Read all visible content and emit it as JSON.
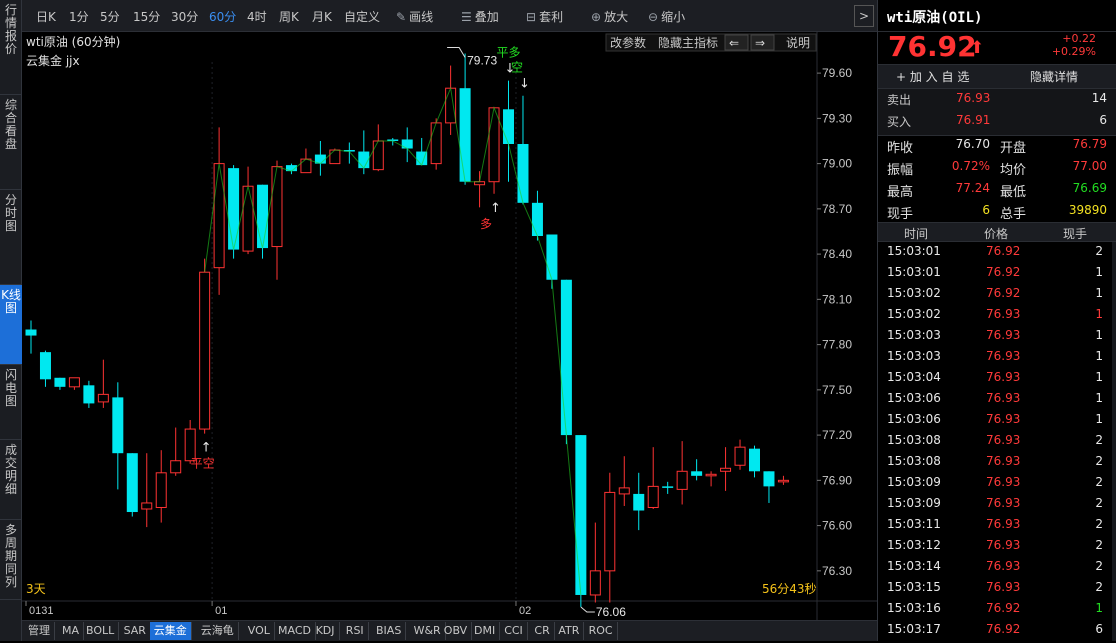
{
  "side_tabs": [
    {
      "label": "行情报价",
      "active": false
    },
    {
      "label": "综合看盘",
      "active": false
    },
    {
      "label": "分时图",
      "active": false
    },
    {
      "label": "K线图",
      "active": true
    },
    {
      "label": "闪电图",
      "active": false
    },
    {
      "label": "成交明细",
      "active": false
    },
    {
      "label": "多周期同列",
      "active": false
    }
  ],
  "toolbar": {
    "periods": [
      {
        "label": "日K",
        "selected": false
      },
      {
        "label": "1分",
        "selected": false
      },
      {
        "label": "5分",
        "selected": false
      },
      {
        "label": "15分",
        "selected": false
      },
      {
        "label": "30分",
        "selected": false
      },
      {
        "label": "60分",
        "selected": true
      },
      {
        "label": "4时",
        "selected": false
      },
      {
        "label": "周K",
        "selected": false
      },
      {
        "label": "月K",
        "selected": false
      },
      {
        "label": "自定义",
        "selected": false
      }
    ],
    "tools": [
      {
        "label": "画线",
        "icon": "pencil-icon"
      },
      {
        "label": "叠加",
        "icon": "stack-icon"
      },
      {
        "label": "套利",
        "icon": "arbitrage-icon"
      },
      {
        "label": "放大",
        "icon": "zoom-in-icon"
      },
      {
        "label": "缩小",
        "icon": "zoom-out-icon"
      }
    ],
    "expand_glyph": ">"
  },
  "chart_header": {
    "title": "wti原油 (60分钟)",
    "indicator": "云集金 jjx",
    "buttons": [
      "改参数",
      "隐藏主指标"
    ],
    "prev_glyph": "⇐",
    "next_glyph": "⇒",
    "help": "说明"
  },
  "chart_footer": {
    "period_left": "3天",
    "countdown": "56分43秒"
  },
  "chart_data": {
    "type": "candlestick",
    "title": "wti原油 (60分钟)",
    "y_ticks": [
      79.6,
      79.3,
      79.0,
      78.7,
      78.4,
      78.1,
      77.8,
      77.5,
      77.2,
      76.9,
      76.6,
      76.3
    ],
    "ylim": [
      76.1,
      79.74
    ],
    "x_date_labels": [
      {
        "index": 0,
        "label": "0131"
      },
      {
        "index": 13,
        "label": "01"
      },
      {
        "index": 34,
        "label": "02"
      }
    ],
    "high_label": "79.73",
    "low_label": "76.06",
    "colors": {
      "up": "#ff3333",
      "down": "#00e8f0",
      "ma": "#22cc22"
    },
    "candles": [
      [
        77.9,
        77.86,
        77.96,
        77.74
      ],
      [
        77.75,
        77.57,
        77.76,
        77.52
      ],
      [
        77.58,
        77.52,
        77.58,
        77.5
      ],
      [
        77.52,
        77.58,
        77.58,
        77.5
      ],
      [
        77.53,
        77.41,
        77.56,
        77.38
      ],
      [
        77.42,
        77.47,
        77.7,
        77.38
      ],
      [
        77.45,
        77.08,
        77.55,
        76.84
      ],
      [
        77.08,
        76.69,
        77.08,
        76.66
      ],
      [
        76.71,
        76.75,
        77.08,
        76.59
      ],
      [
        76.72,
        76.95,
        77.1,
        76.62
      ],
      [
        76.95,
        77.03,
        77.25,
        76.93
      ],
      [
        77.03,
        77.24,
        77.3,
        77.01
      ],
      [
        77.24,
        78.28,
        78.37,
        77.21
      ],
      [
        78.31,
        79.0,
        79.24,
        78.13
      ],
      [
        78.97,
        78.43,
        78.99,
        78.37
      ],
      [
        78.42,
        78.85,
        78.98,
        78.4
      ],
      [
        78.86,
        78.44,
        78.86,
        78.37
      ],
      [
        78.45,
        78.98,
        79.02,
        78.23
      ],
      [
        78.99,
        78.95,
        79.0,
        78.93
      ],
      [
        78.94,
        79.03,
        79.1,
        78.94
      ],
      [
        79.06,
        79.0,
        79.15,
        78.92
      ],
      [
        79.0,
        79.09,
        79.1,
        79.0
      ],
      [
        79.09,
        79.08,
        79.14,
        79.0
      ],
      [
        79.08,
        78.97,
        79.22,
        78.93
      ],
      [
        78.96,
        79.15,
        79.26,
        78.95
      ],
      [
        79.16,
        79.15,
        79.17,
        79.12
      ],
      [
        79.16,
        79.1,
        79.24,
        79.01
      ],
      [
        79.08,
        78.99,
        79.17,
        78.99
      ],
      [
        79.0,
        79.27,
        79.3,
        78.96
      ],
      [
        79.27,
        79.5,
        79.65,
        79.19
      ],
      [
        79.5,
        78.88,
        79.73,
        78.86
      ],
      [
        78.86,
        78.88,
        78.95,
        78.71
      ],
      [
        78.88,
        79.37,
        79.37,
        78.8
      ],
      [
        79.36,
        79.13,
        79.55,
        78.88
      ],
      [
        79.13,
        78.74,
        79.45,
        78.73
      ],
      [
        78.74,
        78.52,
        78.82,
        78.49
      ],
      [
        78.53,
        78.23,
        78.53,
        78.17
      ],
      [
        78.23,
        77.2,
        78.23,
        77.14
      ],
      [
        77.2,
        76.14,
        77.2,
        76.06
      ],
      [
        76.14,
        76.3,
        76.62,
        76.09
      ],
      [
        76.3,
        76.82,
        76.95,
        76.09
      ],
      [
        76.81,
        76.85,
        77.06,
        76.73
      ],
      [
        76.81,
        76.7,
        76.95,
        76.57
      ],
      [
        76.72,
        76.86,
        77.12,
        76.71
      ],
      [
        76.86,
        76.85,
        76.89,
        76.81
      ],
      [
        76.84,
        76.96,
        77.16,
        76.74
      ],
      [
        76.96,
        76.93,
        77.04,
        76.9
      ],
      [
        76.93,
        76.94,
        76.96,
        76.86
      ],
      [
        76.96,
        76.98,
        77.12,
        76.83
      ],
      [
        77.0,
        77.12,
        77.17,
        76.97
      ],
      [
        77.11,
        76.96,
        77.13,
        76.92
      ],
      [
        76.96,
        76.86,
        76.96,
        76.75
      ],
      [
        76.89,
        76.9,
        76.93,
        76.87
      ]
    ],
    "ma_segments": [
      [
        12,
        22
      ],
      [
        22,
        28
      ],
      [
        28,
        30
      ],
      [
        30,
        33
      ],
      [
        33,
        38
      ]
    ],
    "signals": [
      {
        "label": "平空",
        "index": 12,
        "color": "#ff3333",
        "arrow": "up"
      },
      {
        "label": "平多",
        "index": 33,
        "color": "#22dd22",
        "arrow": "down"
      },
      {
        "label": "多",
        "index": 32,
        "color": "#ff3333",
        "arrow": "up"
      },
      {
        "label": "空",
        "index": 34,
        "color": "#22dd22",
        "arrow": "down"
      }
    ]
  },
  "indicator_bar": [
    "管理",
    "MA",
    "BOLL",
    "SAR",
    "云集金",
    "云海龟",
    "VOL",
    "MACD",
    "KDJ",
    "RSI",
    "BIAS",
    "W&R",
    "OBV",
    "DMI",
    "CCI",
    "CR",
    "ATR",
    "ROC"
  ],
  "indicator_selected": "云集金",
  "quote": {
    "name": "wti原油(OIL)",
    "price": "76.92",
    "arrow": "⬆",
    "change": "+0.22",
    "change_pct": "+0.29%",
    "add_watch": "+ 加 入 自 选",
    "hide_detail": "隐藏详情",
    "sell_label": "卖出",
    "sell_price": "76.93",
    "sell_vol": "14",
    "buy_label": "买入",
    "buy_price": "76.91",
    "buy_vol": "6",
    "stats": [
      {
        "l1": "昨收",
        "v1": "76.70",
        "c1": "wht",
        "l2": "开盘",
        "v2": "76.79",
        "c2": "red"
      },
      {
        "l1": "振幅",
        "v1": "0.72%",
        "c1": "red",
        "l2": "均价",
        "v2": "77.00",
        "c2": "red"
      },
      {
        "l1": "最高",
        "v1": "77.24",
        "c1": "red",
        "l2": "最低",
        "v2": "76.69",
        "c2": "grn"
      },
      {
        "l1": "现手",
        "v1": "6",
        "c1": "yel",
        "l2": "总手",
        "v2": "39890",
        "c2": "yel"
      }
    ],
    "trade_headers": [
      "时间",
      "价格",
      "现手"
    ],
    "trades": [
      {
        "t": "15:03:01",
        "p": "76.92",
        "v": "2",
        "vc": "wht"
      },
      {
        "t": "15:03:01",
        "p": "76.92",
        "v": "1",
        "vc": "wht"
      },
      {
        "t": "15:03:02",
        "p": "76.92",
        "v": "1",
        "vc": "wht"
      },
      {
        "t": "15:03:02",
        "p": "76.93",
        "v": "1",
        "vc": "red"
      },
      {
        "t": "15:03:03",
        "p": "76.93",
        "v": "1",
        "vc": "wht"
      },
      {
        "t": "15:03:03",
        "p": "76.93",
        "v": "1",
        "vc": "wht"
      },
      {
        "t": "15:03:04",
        "p": "76.93",
        "v": "1",
        "vc": "wht"
      },
      {
        "t": "15:03:06",
        "p": "76.93",
        "v": "1",
        "vc": "wht"
      },
      {
        "t": "15:03:06",
        "p": "76.93",
        "v": "1",
        "vc": "wht"
      },
      {
        "t": "15:03:08",
        "p": "76.93",
        "v": "2",
        "vc": "wht"
      },
      {
        "t": "15:03:08",
        "p": "76.93",
        "v": "2",
        "vc": "wht"
      },
      {
        "t": "15:03:09",
        "p": "76.93",
        "v": "2",
        "vc": "wht"
      },
      {
        "t": "15:03:09",
        "p": "76.93",
        "v": "2",
        "vc": "wht"
      },
      {
        "t": "15:03:11",
        "p": "76.93",
        "v": "2",
        "vc": "wht"
      },
      {
        "t": "15:03:12",
        "p": "76.93",
        "v": "2",
        "vc": "wht"
      },
      {
        "t": "15:03:14",
        "p": "76.93",
        "v": "2",
        "vc": "wht"
      },
      {
        "t": "15:03:15",
        "p": "76.93",
        "v": "2",
        "vc": "wht"
      },
      {
        "t": "15:03:16",
        "p": "76.92",
        "v": "1",
        "vc": "grn"
      },
      {
        "t": "15:03:17",
        "p": "76.92",
        "v": "6",
        "vc": "wht"
      }
    ]
  }
}
